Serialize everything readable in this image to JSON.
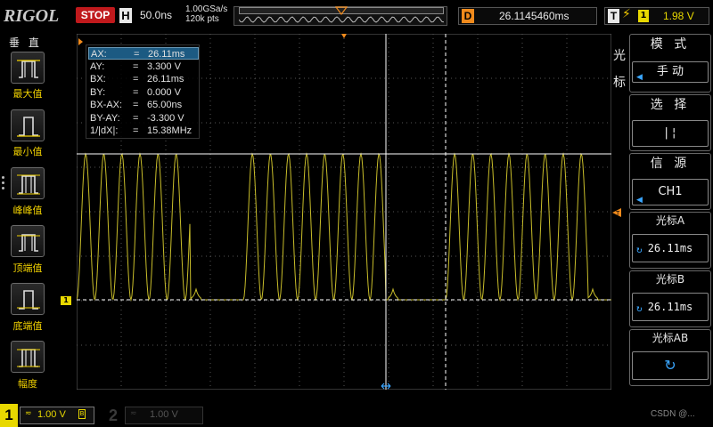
{
  "brand": "RIGOL",
  "run_state": "STOP",
  "timebase": {
    "label": "H",
    "value": "50.0ns"
  },
  "acquisition": {
    "sample_rate": "1.00GSa/s",
    "memory_depth": "120k pts"
  },
  "delay": {
    "label": "D",
    "value": "26.1145460ms"
  },
  "trigger": {
    "label": "T",
    "edge_icon": "rising-edge-icon",
    "source": "1",
    "level": "1.98 V"
  },
  "left_menu": {
    "title": "垂 直",
    "items": [
      {
        "label": "最大值",
        "icon": "max-measure-icon"
      },
      {
        "label": "最小值",
        "icon": "min-measure-icon"
      },
      {
        "label": "峰峰值",
        "icon": "peak-peak-icon"
      },
      {
        "label": "顶端值",
        "icon": "top-measure-icon"
      },
      {
        "label": "底端值",
        "icon": "base-measure-icon"
      },
      {
        "label": "幅度",
        "icon": "amplitude-icon"
      }
    ]
  },
  "cursor_readout": {
    "rows": [
      {
        "key": "AX:",
        "value": "26.11ms"
      },
      {
        "key": "AY:",
        "value": "3.300 V"
      },
      {
        "key": "BX:",
        "value": "26.11ms"
      },
      {
        "key": "BY:",
        "value": "0.000 V"
      },
      {
        "key": "BX-AX:",
        "value": "65.00ns"
      },
      {
        "key": "BY-AY:",
        "value": "-3.300 V"
      },
      {
        "key": "1/|dX|:",
        "value": "15.38MHz"
      }
    ],
    "eq": "="
  },
  "right_menu": {
    "side_label_1": "光",
    "side_label_2": "标",
    "mode": {
      "title": "模 式",
      "value": "手 动"
    },
    "select": {
      "title": "选 择",
      "value": "|     ¦"
    },
    "source": {
      "title": "信 源",
      "value": "CH1"
    },
    "cursor_a": {
      "title": "光标A",
      "value": "26.11ms"
    },
    "cursor_b": {
      "title": "光标B",
      "value": "26.11ms"
    },
    "cursor_ab": {
      "title": "光标AB"
    }
  },
  "channel1": {
    "number": "1",
    "coupling_icon": "ac-coupling-icon",
    "scale": "1.00 V",
    "bw_label": "B"
  },
  "channel2": {
    "number": "2",
    "coupling_icon": "ac-coupling-icon",
    "scale": "1.00 V"
  },
  "watermark": "CSDN @...",
  "colors": {
    "ch1": "#e8d800",
    "stop": "#c0191c",
    "delay": "#f08a1c",
    "grid": "#555555",
    "cursor": "#ffffff"
  }
}
